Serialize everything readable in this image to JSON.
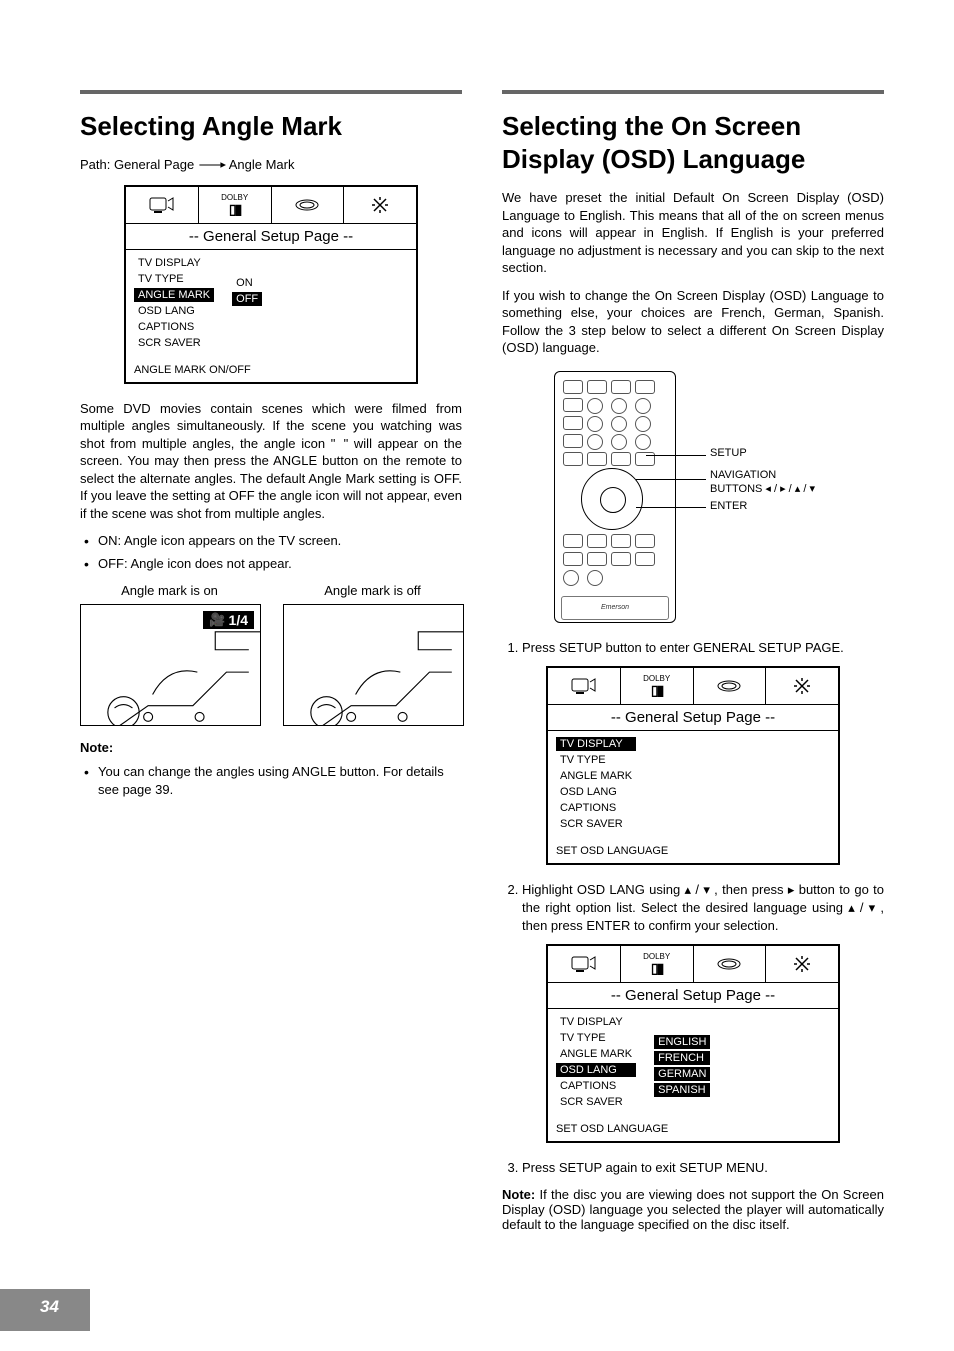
{
  "page_number": "34",
  "left": {
    "title": "Selecting Angle Mark",
    "path_prefix": "Path: General Page",
    "path_target": "Angle Mark",
    "osd": {
      "dolby": "DOLBY",
      "title": "-- General  Setup  Page --",
      "items": [
        "TV DISPLAY",
        "TV TYPE",
        "ANGLE MARK",
        "OSD LANG",
        "CAPTIONS",
        "SCR SAVER"
      ],
      "selected_index": 2,
      "options": [
        "ON",
        "OFF"
      ],
      "option_selected_index": 1,
      "hint": "ANGLE MARK ON/OFF"
    },
    "para1": "Some DVD movies contain scenes which were filmed from multiple angles simultaneously. If the scene you watching was shot from multiple angles, the angle icon \"  \" will appear on the screen. You may then press the ANGLE button on the remote to select the alternate angles. The default Angle Mark setting is OFF. If you leave the setting at OFF the angle icon will not appear, even if the scene was shot from multiple angles.",
    "bullets": [
      "ON: Angle icon appears on the TV screen.",
      "OFF: Angle icon does not appear."
    ],
    "illus_on": "Angle mark is on",
    "illus_off": "Angle mark is off",
    "angle_badge": "1/4",
    "note_head": "Note:",
    "note_bullet": "You can change the angles using ANGLE button. For details see page 39."
  },
  "right": {
    "title": "Selecting the On Screen Display (OSD) Language",
    "para1": "We have preset the initial Default On Screen Display (OSD) Language to English. This means that all of the on screen menus and icons will appear in English. If English is your preferred language no adjustment is necessary and you can skip to the next section.",
    "para2": "If you wish to change the On Screen Display (OSD) Language to something else, your choices are French, German, Spanish. Follow the 3 step below to select a different On Screen Display (OSD) language.",
    "remote": {
      "setup": "SETUP",
      "nav1": "NAVIGATION",
      "nav2": "BUTTONS ◂ / ▸ / ▴ / ▾",
      "enter": "ENTER",
      "brand": "Emerson"
    },
    "step1": "Press SETUP button to enter GENERAL SETUP PAGE.",
    "osd1": {
      "dolby": "DOLBY",
      "title": "-- General  Setup  Page --",
      "items": [
        "TV DISPLAY",
        "TV TYPE",
        "ANGLE MARK",
        "OSD LANG",
        "CAPTIONS",
        "SCR SAVER"
      ],
      "selected_index": 0,
      "hint": "SET OSD LANGUAGE"
    },
    "step2": "Highlight OSD LANG using ▴ / ▾ , then press  ▸ button to go to the right option list. Select the desired language using ▴ / ▾ , then press ENTER to confirm your selection.",
    "osd2": {
      "dolby": "DOLBY",
      "title": "-- General  Setup  Page --",
      "items": [
        "TV DISPLAY",
        "TV TYPE",
        "ANGLE MARK",
        "OSD LANG",
        "CAPTIONS",
        "SCR SAVER"
      ],
      "selected_index": 3,
      "options": [
        "ENGLISH",
        "FRENCH",
        "GERMAN",
        "SPANISH"
      ],
      "option_sel_all": true,
      "hint": "SET OSD LANGUAGE"
    },
    "step3": "Press SETUP again to exit SETUP MENU.",
    "note_label": "Note:",
    "note_body": "If the disc you are viewing does not support the On Screen Display (OSD) language you selected the player will automatically default to the language specified on the disc itself."
  }
}
